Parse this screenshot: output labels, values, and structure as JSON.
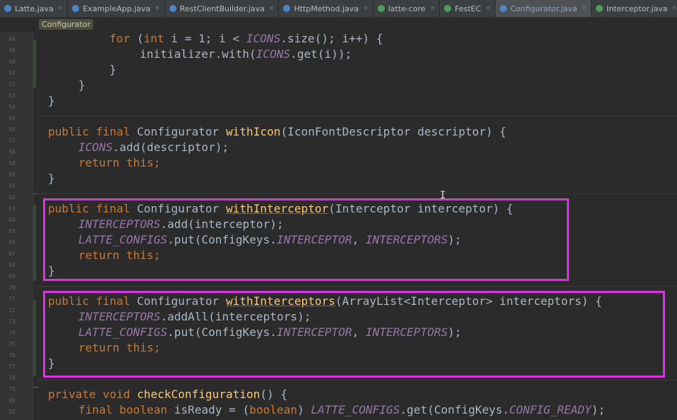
{
  "tabs": [
    {
      "label": "Latte.java",
      "icon": "class-icon",
      "color": "#4a86c8",
      "active": false
    },
    {
      "label": "ExampleApp.java",
      "icon": "class-icon",
      "color": "#4a86c8",
      "active": false
    },
    {
      "label": "RestClientBuilder.java",
      "icon": "class-icon",
      "color": "#4a86c8",
      "active": false
    },
    {
      "label": "HttpMethod.java",
      "icon": "enum-icon",
      "color": "#4a86c8",
      "active": false
    },
    {
      "label": "latte-core",
      "icon": "module-icon",
      "color": "#4b9d5b",
      "active": false
    },
    {
      "label": "FestEC",
      "icon": "module-icon",
      "color": "#4b9d5b",
      "active": false
    },
    {
      "label": "Configurator.java",
      "icon": "class-icon",
      "color": "#4a86c8",
      "active": true
    },
    {
      "label": "Interceptor.java",
      "icon": "interface-icon",
      "color": "#4b9d5b",
      "active": false
    }
  ],
  "breadcrumb": "Configurator",
  "line_numbers": [
    "48",
    "49",
    "50",
    "51",
    "52",
    "53",
    "54",
    "55",
    "56",
    "57",
    "58",
    "59",
    "60",
    "61",
    "62",
    "63",
    "64",
    "65",
    "66",
    "67",
    "68",
    "69",
    "70",
    "71",
    "72",
    "73",
    "74",
    "75",
    "76",
    "77",
    "78",
    "79",
    "80",
    "81"
  ],
  "code": {
    "l48": {
      "a": "for",
      "b": " (",
      "c": "int",
      "d": " i = 1; i < ",
      "e": "ICONS",
      "f": ".size(); i++) {"
    },
    "l49": {
      "a": "initializer.with(",
      "b": "ICONS",
      "c": ".get(i));"
    },
    "l50": "}",
    "l51": "}",
    "l52": "}",
    "l54": {
      "a": "public final",
      "b": " Configurator ",
      "c": "withIcon",
      "d": "(IconFontDescriptor descriptor) {"
    },
    "l55": {
      "a": "ICONS",
      "b": ".add(descriptor);"
    },
    "l56": {
      "a": "return this",
      "b": ";"
    },
    "l57": "}",
    "l59": {
      "a": "public final",
      "b": " Configurator ",
      "c": "withInterceptor",
      "d": "(Interceptor interceptor) {"
    },
    "l60": {
      "a": "INTERCEPTORS",
      "b": ".add(interceptor);"
    },
    "l61": {
      "a": "LATTE_CONFIGS",
      "b": ".put(ConfigKeys.",
      "c": "INTERCEPTOR",
      "d": ", ",
      "e": "INTERCEPTORS",
      "f": ");"
    },
    "l62": {
      "a": "return this",
      "b": ";"
    },
    "l63": "}",
    "l65": {
      "a": "public final",
      "b": " Configurator ",
      "c": "withInterceptors",
      "d": "(ArrayList<Interceptor> interceptors) {"
    },
    "l66": {
      "a": "INTERCEPTORS",
      "b": ".addAll(interceptors);"
    },
    "l67": {
      "a": "LATTE_CONFIGS",
      "b": ".put(ConfigKeys.",
      "c": "INTERCEPTOR",
      "d": ", ",
      "e": "INTERCEPTORS",
      "f": ");"
    },
    "l68": {
      "a": "return this",
      "b": ";"
    },
    "l69": "}",
    "l71": {
      "a": "private void",
      "b": " ",
      "c": "checkConfiguration",
      "d": "() {"
    },
    "l72": {
      "a": "final boolean",
      "b": " isReady = (",
      "c": "boolean",
      "d": ") ",
      "e": "LATTE_CONFIGS",
      "f": ".get(ConfigKeys.",
      "g": "CONFIG_READY",
      "h": ");"
    }
  },
  "colors": {
    "background": "#2b2b2b",
    "keyword": "#cc7832",
    "static_field": "#9876aa",
    "method_decl": "#ffc66d",
    "text": "#a9b7c6",
    "highlight_box": "#e22ee8"
  }
}
